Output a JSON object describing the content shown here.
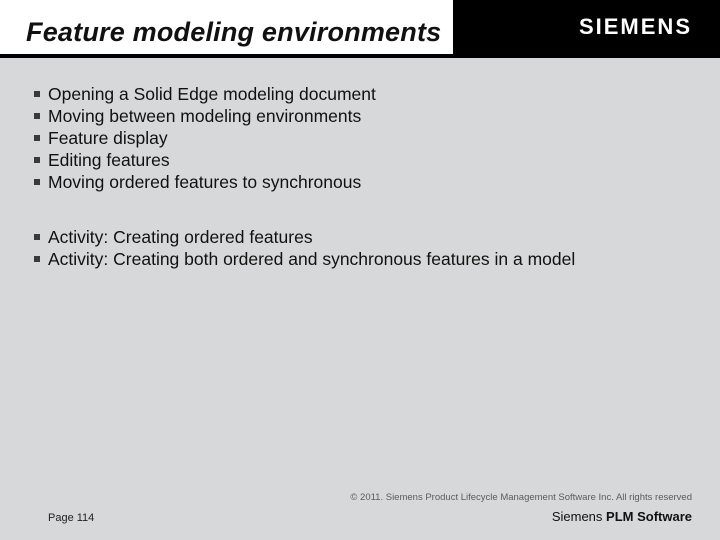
{
  "header": {
    "title": "Feature modeling environments",
    "brand": "SIEMENS"
  },
  "topics": [
    "Opening a Solid Edge modeling document",
    "Moving between modeling environments",
    "Feature display",
    "Editing features",
    "Moving ordered features to synchronous"
  ],
  "activities": [
    "Activity: Creating ordered features",
    "Activity: Creating both ordered and synchronous features in a model"
  ],
  "footer": {
    "copyright": "© 2011. Siemens Product Lifecycle Management Software Inc. All rights reserved",
    "page": "Page 114",
    "product_prefix": "Siemens ",
    "product_bold": "PLM Software"
  }
}
